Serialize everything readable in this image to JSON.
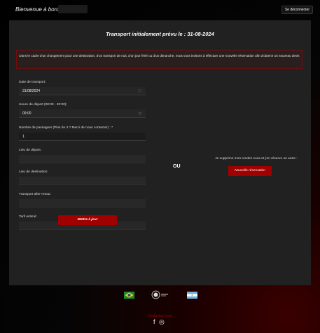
{
  "header": {
    "welcome": "Bienvenue à bord",
    "logout_label": "Se déconnecter"
  },
  "main": {
    "title": "Transport initialement prévu le : 31-08-2024",
    "notice": "Dans le cadre d'un changement pour une destination, d'un transport de nuit, d'un jour férié ou d'un dimanche, nous vous invitons à effectuer une nouvelle réservation afin d'obtenir un nouveau devis"
  },
  "form": {
    "date_label": "Date de transport:",
    "date_value": "31/08/2024",
    "time_label": "Heure de départ (08:00 - 20:00):",
    "time_value": "09:00",
    "passengers_label": "Nombre de passagers (Plus de 4 ? Merci de nous contacter) : *",
    "passengers_value": "1",
    "departure_label": "Lieu de départ:",
    "destination_label": "Lieu de destination:",
    "return_label": "Transport aller-retour:",
    "price_label": "Tarif estimé:",
    "update_label": "Mettre à jour"
  },
  "alternative": {
    "or_label": "OU",
    "text": "Je supprime mon rendez-vous et j'en réserve un autre :",
    "new_label": "Nouvelle réservation"
  },
  "footer": {
    "social_label": "Contactez-nous"
  },
  "colors": {
    "accent": "#a00000",
    "panel": "#212121"
  }
}
